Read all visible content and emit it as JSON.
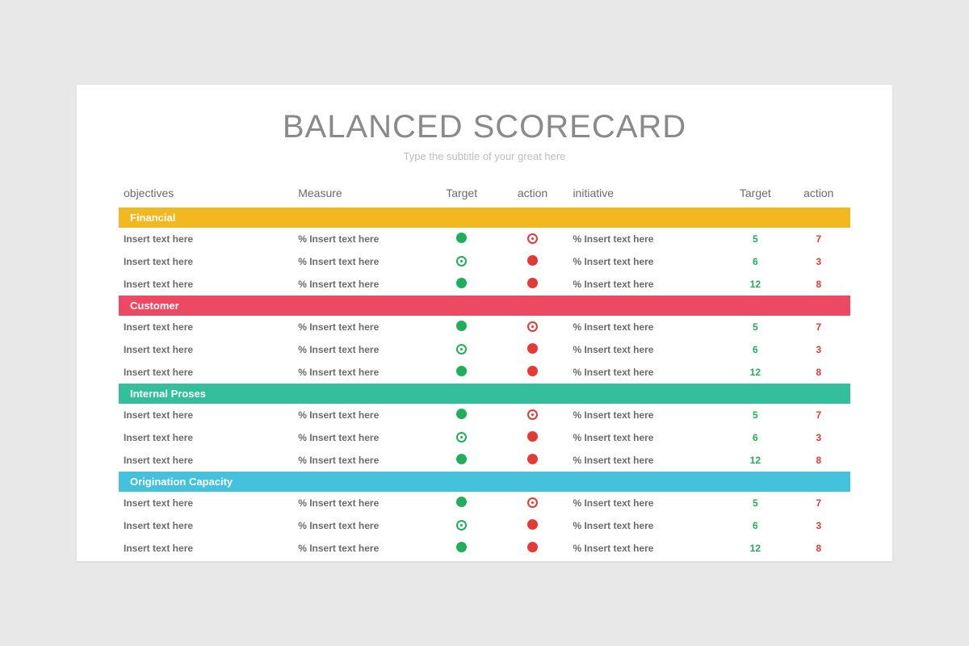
{
  "title": "BALANCED SCORECARD",
  "subtitle": "Type the subtitle of your great here",
  "columns": {
    "objectives": "objectives",
    "measure": "Measure",
    "target1": "Target",
    "action1": "action",
    "initiative": "initiative",
    "target2": "Target",
    "action2": "action"
  },
  "sections": [
    {
      "label": "Financial",
      "color": "yellow",
      "rows": [
        {
          "obj": "Insert text here",
          "meas": "% Insert text here",
          "t1": "green-solid",
          "a1": "red-ring",
          "init": "% Insert text here",
          "t2": "5",
          "a2": "7"
        },
        {
          "obj": "Insert text here",
          "meas": "% Insert text here",
          "t1": "green-ring",
          "a1": "red-solid",
          "init": "% Insert text here",
          "t2": "6",
          "a2": "3"
        },
        {
          "obj": "Insert text here",
          "meas": "% Insert text here",
          "t1": "green-solid",
          "a1": "red-solid",
          "init": "% Insert text here",
          "t2": "12",
          "a2": "8"
        }
      ]
    },
    {
      "label": "Customer",
      "color": "pink",
      "rows": [
        {
          "obj": "Insert text here",
          "meas": "% Insert text here",
          "t1": "green-solid",
          "a1": "red-ring",
          "init": "% Insert text here",
          "t2": "5",
          "a2": "7"
        },
        {
          "obj": "Insert text here",
          "meas": "% Insert text here",
          "t1": "green-ring",
          "a1": "red-solid",
          "init": "% Insert text here",
          "t2": "6",
          "a2": "3"
        },
        {
          "obj": "Insert text here",
          "meas": "% Insert text here",
          "t1": "green-solid",
          "a1": "red-solid",
          "init": "% Insert text here",
          "t2": "12",
          "a2": "8"
        }
      ]
    },
    {
      "label": "Internal Proses",
      "color": "teal",
      "rows": [
        {
          "obj": "Insert text here",
          "meas": "% Insert text here",
          "t1": "green-solid",
          "a1": "red-ring",
          "init": "% Insert text here",
          "t2": "5",
          "a2": "7"
        },
        {
          "obj": "Insert text here",
          "meas": "% Insert text here",
          "t1": "green-ring",
          "a1": "red-solid",
          "init": "% Insert text here",
          "t2": "6",
          "a2": "3"
        },
        {
          "obj": "Insert text here",
          "meas": "% Insert text here",
          "t1": "green-solid",
          "a1": "red-solid",
          "init": "% Insert text here",
          "t2": "12",
          "a2": "8"
        }
      ]
    },
    {
      "label": "Origination Capacity",
      "color": "blue",
      "rows": [
        {
          "obj": "Insert text here",
          "meas": "% Insert text here",
          "t1": "green-solid",
          "a1": "red-ring",
          "init": "% Insert text here",
          "t2": "5",
          "a2": "7"
        },
        {
          "obj": "Insert text here",
          "meas": "% Insert text here",
          "t1": "green-ring",
          "a1": "red-solid",
          "init": "% Insert text here",
          "t2": "6",
          "a2": "3"
        },
        {
          "obj": "Insert text here",
          "meas": "% Insert text here",
          "t1": "green-solid",
          "a1": "red-solid",
          "init": "% Insert text here",
          "t2": "12",
          "a2": "8"
        }
      ]
    }
  ]
}
